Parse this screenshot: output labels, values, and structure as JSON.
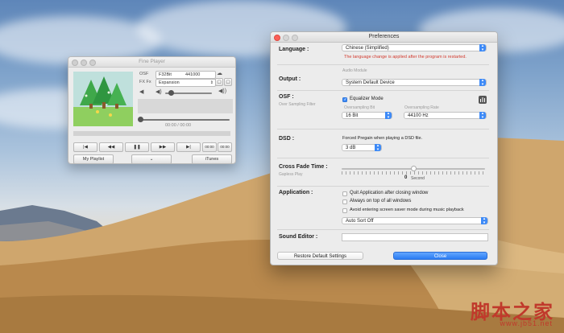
{
  "player": {
    "title": "Fine Player",
    "format_label": "OSF",
    "format_value": "F32Bit",
    "rate_value": "441000",
    "fx_label": "FX Fx",
    "fx_value": "Expansion",
    "time": "00:00 / 00:00",
    "btn_playlist": "My Playlist",
    "btn_itunes": "iTunes",
    "small_btn_a": "00:00",
    "small_btn_b": "00:00",
    "transport": [
      "|◀",
      "◀◀",
      "❚❚",
      "▶▶",
      "▶|"
    ]
  },
  "prefs": {
    "title": "Preferences",
    "language": {
      "label": "Language :",
      "value": "Chinese (Simplified)",
      "note": "The language change is applied after the program is restarted."
    },
    "output": {
      "label": "Output :",
      "sub": "Audio Module",
      "value": "System Default Device"
    },
    "osf": {
      "label": "OSF :",
      "sub": "Over Sampling Filter",
      "eq_label": "Equalizer Mode",
      "eq_checked": true,
      "bit_label": "Oversampling Bit",
      "bit_value": "16 Bit",
      "rate_label": "Oversampling Rate",
      "rate_value": "44100 Hz"
    },
    "dsd": {
      "label": "DSD :",
      "text": "Forced Pregain when playing a DSD file.",
      "value": "3 dB"
    },
    "crossfade": {
      "label": "Cross Fade Time :",
      "sub": "Gapless Play",
      "value": "0",
      "unit": "Second",
      "level": 0
    },
    "application": {
      "label": "Application :",
      "options": [
        {
          "label": "Quit Application after closing window",
          "checked": false
        },
        {
          "label": "Always on top of all windows",
          "checked": false
        },
        {
          "label": "Avoid entering screen saver mode during music playback",
          "checked": false
        }
      ],
      "sort_value": "Auto Sort Off"
    },
    "sound_editor": {
      "label": "Sound Editor :",
      "value": ""
    },
    "restore_label": "Restore Default Settings",
    "close_label": "Close"
  },
  "watermark": {
    "cn": "脚本之家",
    "url": "www.jb51.net"
  },
  "colors": {
    "accent": "#3d8af7",
    "warning": "#d23b2f"
  }
}
